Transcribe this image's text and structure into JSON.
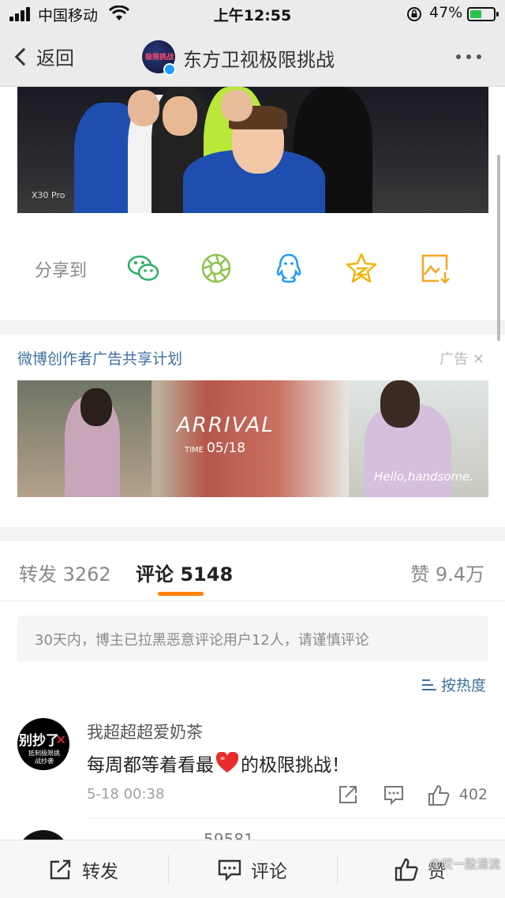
{
  "status_bar": {
    "carrier": "中国移动",
    "time": "上午12:55",
    "battery": "47%"
  },
  "nav": {
    "back_label": "返回",
    "title": "东方卫视极限挑战",
    "avatar_text": "极限挑战"
  },
  "post": {
    "photo_watermark": "X30 Pro"
  },
  "share": {
    "label": "分享到",
    "targets": [
      "wechat-icon",
      "moments-icon",
      "qq-icon",
      "qzone-icon",
      "save-image-icon"
    ]
  },
  "ad": {
    "title": "微博创作者广告共享计划",
    "tag": "广告",
    "headline": "ARRIVAL",
    "date_prefix": "TIME",
    "date": "05/18",
    "handwriting": "Hello,handsome."
  },
  "tabs": {
    "repost": "转发 3262",
    "comment": "评论 5148",
    "like": "赞 9.4万"
  },
  "notice": "30天内，博主已拉黑恶意评论用户12人，请谨慎评论",
  "sort_label": "按热度",
  "comments": [
    {
      "avatar_text": "别抄了",
      "avatar_subtext": "抵制极限挑战抄袭",
      "name": "我超超超爱奶茶",
      "text_before": "每周都等着看最",
      "text_after": "的极限挑战！",
      "time": "5-18 00:38",
      "likes": "402"
    }
  ],
  "next_comment_name": "......59581",
  "toolbar": {
    "repost": "转发",
    "comment": "评论",
    "like": "赞",
    "watermark": "@哎一股清流"
  },
  "colors": {
    "accent": "#ff8200",
    "link": "#3d6fa0",
    "wechat": "#2aae67",
    "qq": "#1e9bff",
    "qzone": "#f5b400",
    "save": "#f5a623"
  }
}
